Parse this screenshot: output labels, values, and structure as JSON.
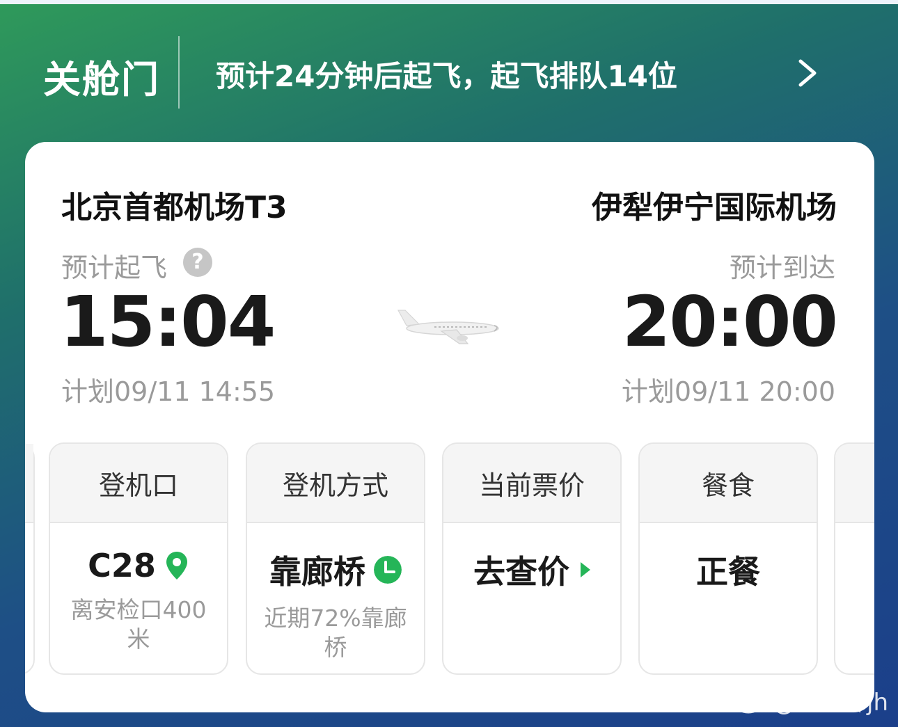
{
  "header": {
    "status": "关舱门",
    "message": "预计24分钟后起飞，起飞排队14位"
  },
  "departure": {
    "airport": "北京首都机场T3",
    "label": "预计起飞",
    "time": "15:04",
    "planned": "计划09/11 14:55"
  },
  "arrival": {
    "airport": "伊犁伊宁国际机场",
    "label": "预计到达",
    "time": "20:00",
    "planned": "计划09/11 20:00"
  },
  "tiles": [
    {
      "title": "登机口",
      "value": "C28",
      "sub": "离安检口400米",
      "icon": "location-pin-icon"
    },
    {
      "title": "登机方式",
      "value": "靠廊桥",
      "sub": "近期72%靠廊桥",
      "icon": "clock-icon"
    },
    {
      "title": "当前票价",
      "value": "去查价",
      "sub": "",
      "icon": "play-arrow-icon"
    },
    {
      "title": "餐食",
      "value": "正餐",
      "sub": "",
      "icon": ""
    }
  ],
  "watermark": "@张建辉jh",
  "colors": {
    "accent_green": "#25b558",
    "bg_top": "#2f9a5a",
    "bg_bottom": "#1b3f8a"
  }
}
